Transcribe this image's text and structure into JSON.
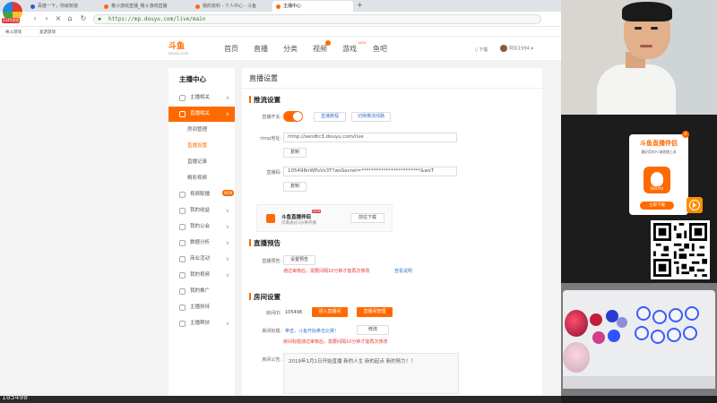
{
  "browser": {
    "logo_label": "2345浏览",
    "tabs": [
      "百度一下，你就知道",
      "格斗游戏直播_格斗游戏直播",
      "我的资料 - 个人中心 - 斗鱼",
      "主播中心"
    ],
    "new_tab": "+",
    "url": "https://mp.douyu.com/live/main",
    "bookmarks": [
      "格斗游戏",
      "爱游游戏"
    ]
  },
  "site": {
    "logo": "斗鱼",
    "logo_sub": "DOUYU.COM",
    "nav": [
      "首页",
      "直播",
      "分类",
      "视频",
      "游戏",
      "鱼吧"
    ],
    "nav_new_tag": "NEW",
    "download": "下载",
    "user": "阿乐1994"
  },
  "sidebar": {
    "title": "主播中心",
    "items": [
      {
        "label": "主播相关",
        "arrow": "∧"
      },
      {
        "label": "直播相关",
        "arrow": "∧"
      },
      {
        "label": "视频配播",
        "arrow": "∨"
      },
      {
        "label": "我的收益",
        "arrow": "∨"
      },
      {
        "label": "我的公会",
        "arrow": "∨"
      },
      {
        "label": "数据分析",
        "arrow": "∨"
      },
      {
        "label": "商业活动",
        "arrow": "∨"
      },
      {
        "label": "我的视频",
        "arrow": "∨"
      },
      {
        "label": "我的推广",
        "arrow": ""
      },
      {
        "label": "主播扶持",
        "arrow": ""
      },
      {
        "label": "主播帮扶",
        "arrow": "∨"
      }
    ],
    "subitems": [
      "房间管理",
      "直播设置",
      "直播记录",
      "精彩视频"
    ],
    "new_badge": "NEW"
  },
  "main": {
    "title": "直播设置",
    "push": {
      "section": "推流设置",
      "switch_label": "直播开关:",
      "link1": "直播教程",
      "link2": "切换推流线路",
      "rtmp_label": "rtmp地址:",
      "rtmp_value": "rtmp://sendtc3.douyu.com/live",
      "copy": "复制",
      "code_label": "直播码:",
      "code_value": "105498nWPsVs3T?wsSecret=************************&wsT",
      "copy2": "复制"
    },
    "promo": {
      "title": "斗鱼直播伴侣",
      "new": "NEW",
      "sub": "仅需通过3分钟开播",
      "button": "前往下载"
    },
    "preview": {
      "section": "直播预告",
      "label": "直播预告:",
      "button": "设置预告",
      "warning": "通过审核后，需要间隔10分钟才能再次修改",
      "link": "查看说明"
    },
    "room": {
      "section": "房间设置",
      "id_label": "房间ID:",
      "id_value": "105498",
      "btn_enter": "进入直播间",
      "btn_manage": "直播间管理",
      "title_label": "房间标题:",
      "title_value": "拳皇，斗鱼开始拳击比赛！",
      "edit": "修改",
      "warning": "房间标题通过审核后，需要间隔10分钟才能再次修改",
      "notice_label": "房间公告:",
      "notice_value": "2019年1月1日开始直播 新的人生 新的起点 新的努力！！"
    }
  },
  "overlay": {
    "counter": "105498",
    "companion_title": "斗鱼直播伴侣",
    "companion_sub": "最好用的PC端直播工具",
    "companion_logo_text": "DOUYU",
    "companion_button": "立即下载",
    "close": "×"
  }
}
